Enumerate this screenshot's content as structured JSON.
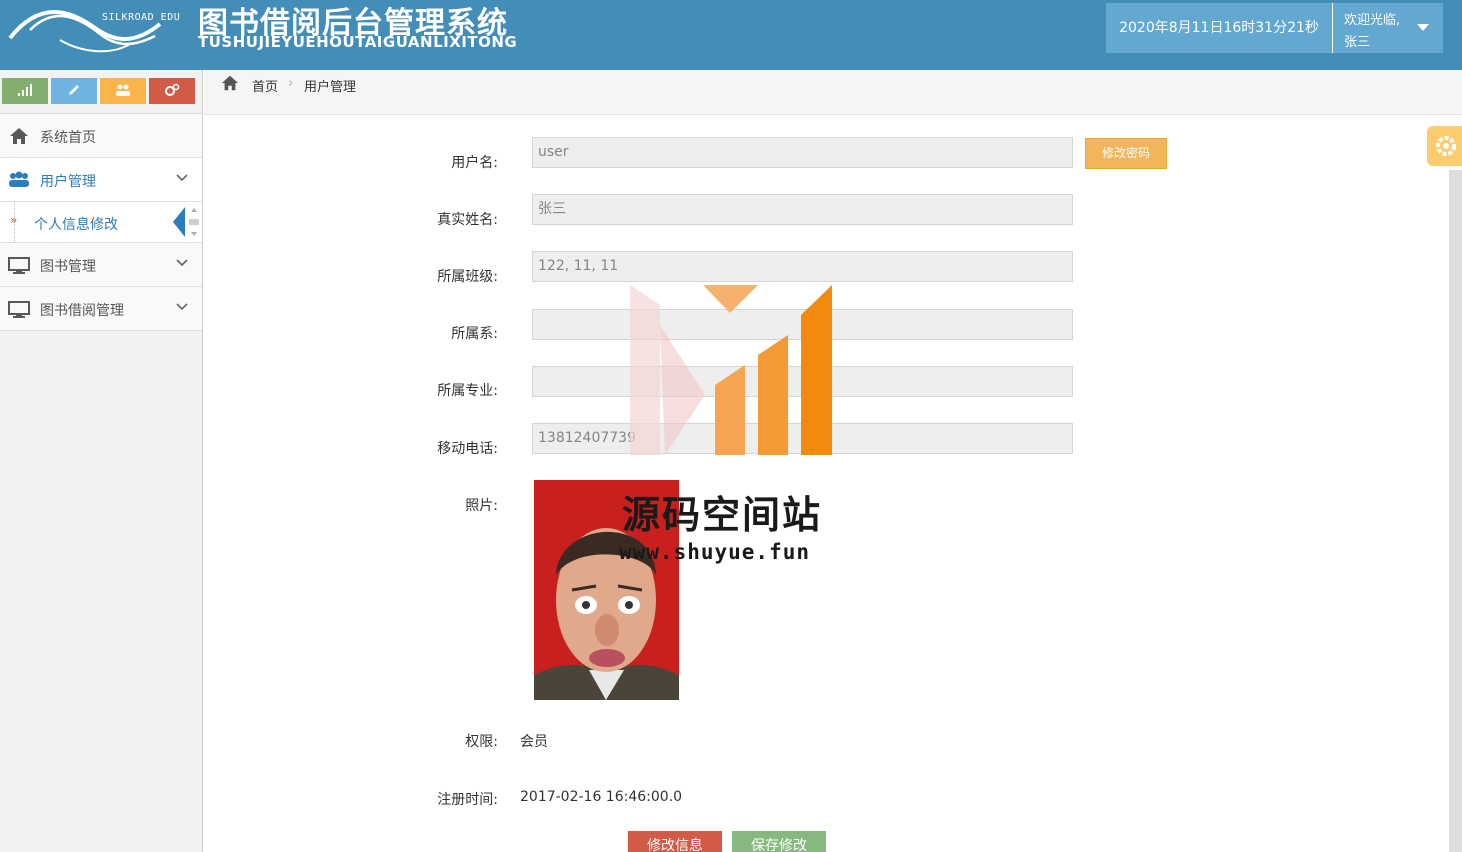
{
  "header": {
    "logo_text": "SILKROAD EDU",
    "title": "图书借阅后台管理系统",
    "subtitle": "TUSHUJIEYUEHOUTAIGUANLIXITONG",
    "datetime": "2020年8月11日16时31分21秒",
    "welcome": "欢迎光临,",
    "username": "张三"
  },
  "shortcuts": [
    {
      "icon": "signal-icon",
      "color": "#82af6f"
    },
    {
      "icon": "pencil-icon",
      "color": "#6fb3e0"
    },
    {
      "icon": "users-icon",
      "color": "#fee188"
    },
    {
      "icon": "cogs-icon",
      "color": "#d15b47"
    }
  ],
  "sidebar": {
    "items": [
      {
        "label": "系统首页",
        "icon": "home-icon"
      },
      {
        "label": "用户管理",
        "icon": "users-icon"
      },
      {
        "label": "个人信息修改"
      },
      {
        "label": "图书管理",
        "icon": "desktop-icon"
      },
      {
        "label": "图书借阅管理",
        "icon": "desktop-icon"
      }
    ]
  },
  "breadcrumb": {
    "home": "首页",
    "current": "用户管理"
  },
  "form": {
    "username_label": "用户名:",
    "username_value": "user",
    "change_pwd_label": "修改密码",
    "realname_label": "真实姓名:",
    "realname_value": "张三",
    "class_label": "所属班级:",
    "class_value": "122, 11, 11",
    "dept_label": "所属系:",
    "dept_value": "",
    "major_label": "所属专业:",
    "major_value": "",
    "phone_label": "移动电话:",
    "phone_value": "13812407739",
    "photo_label": "照片:",
    "role_label": "权限:",
    "role_value": "会员",
    "regtime_label": "注册时间:",
    "regtime_value": "2017-02-16 16:46:00.0",
    "edit_button": "修改信息",
    "save_button": "保存修改"
  },
  "watermark": {
    "name": "源码空间站",
    "url": "www.shuyue.fun"
  }
}
